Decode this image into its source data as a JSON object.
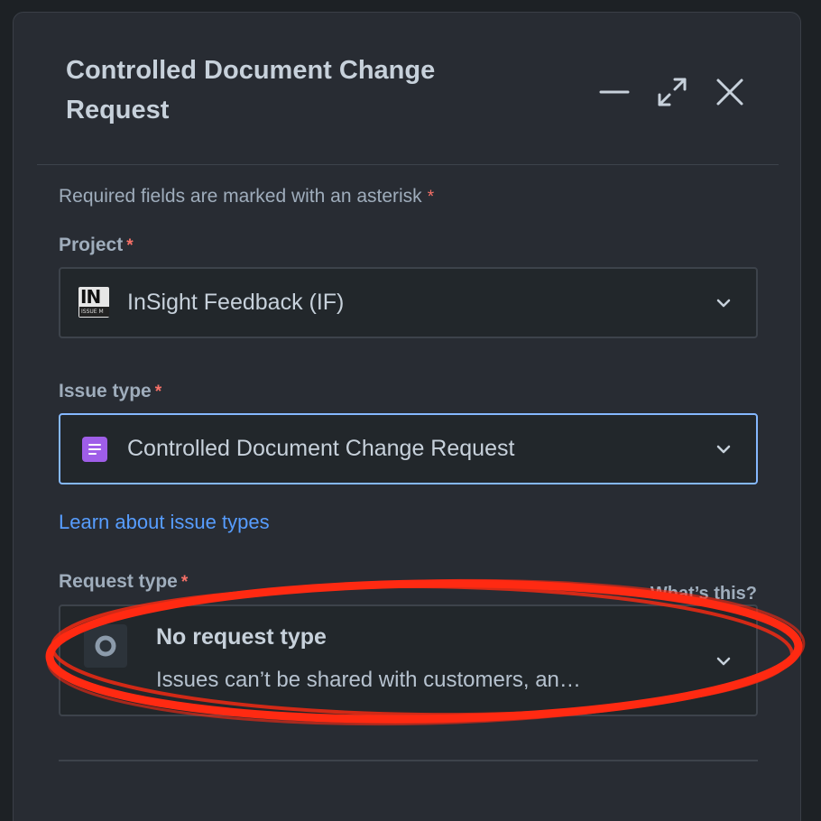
{
  "dialog": {
    "title": "Controlled Document Change Request",
    "header_buttons": {
      "minimize_icon": "minimize-icon",
      "expand_icon": "expand-icon",
      "close_icon": "close-icon"
    }
  },
  "form": {
    "required_note": "Required fields are marked with an asterisk",
    "asterisk": "*",
    "project": {
      "label": "Project",
      "value": "InSight Feedback (IF)",
      "icon_text": "IN",
      "icon_subtext": "ISSUE M"
    },
    "issue_type": {
      "label": "Issue type",
      "value": "Controlled Document Change Request",
      "icon": "document-icon"
    },
    "learn_link": "Learn about issue types",
    "request_type": {
      "label": "Request type",
      "help_link": "What’s this?",
      "title": "No request type",
      "description": "Issues can’t be shared with customers, an…"
    }
  },
  "colors": {
    "background": "#1d2125",
    "dialog": "#282c33",
    "text": "#c7d1db",
    "subtle_text": "#9fadbc",
    "link": "#579dff",
    "required": "#f87168",
    "focus_border": "#85b8ff",
    "issue_icon": "#9f5ee8",
    "annotation": "#ff2a12"
  }
}
